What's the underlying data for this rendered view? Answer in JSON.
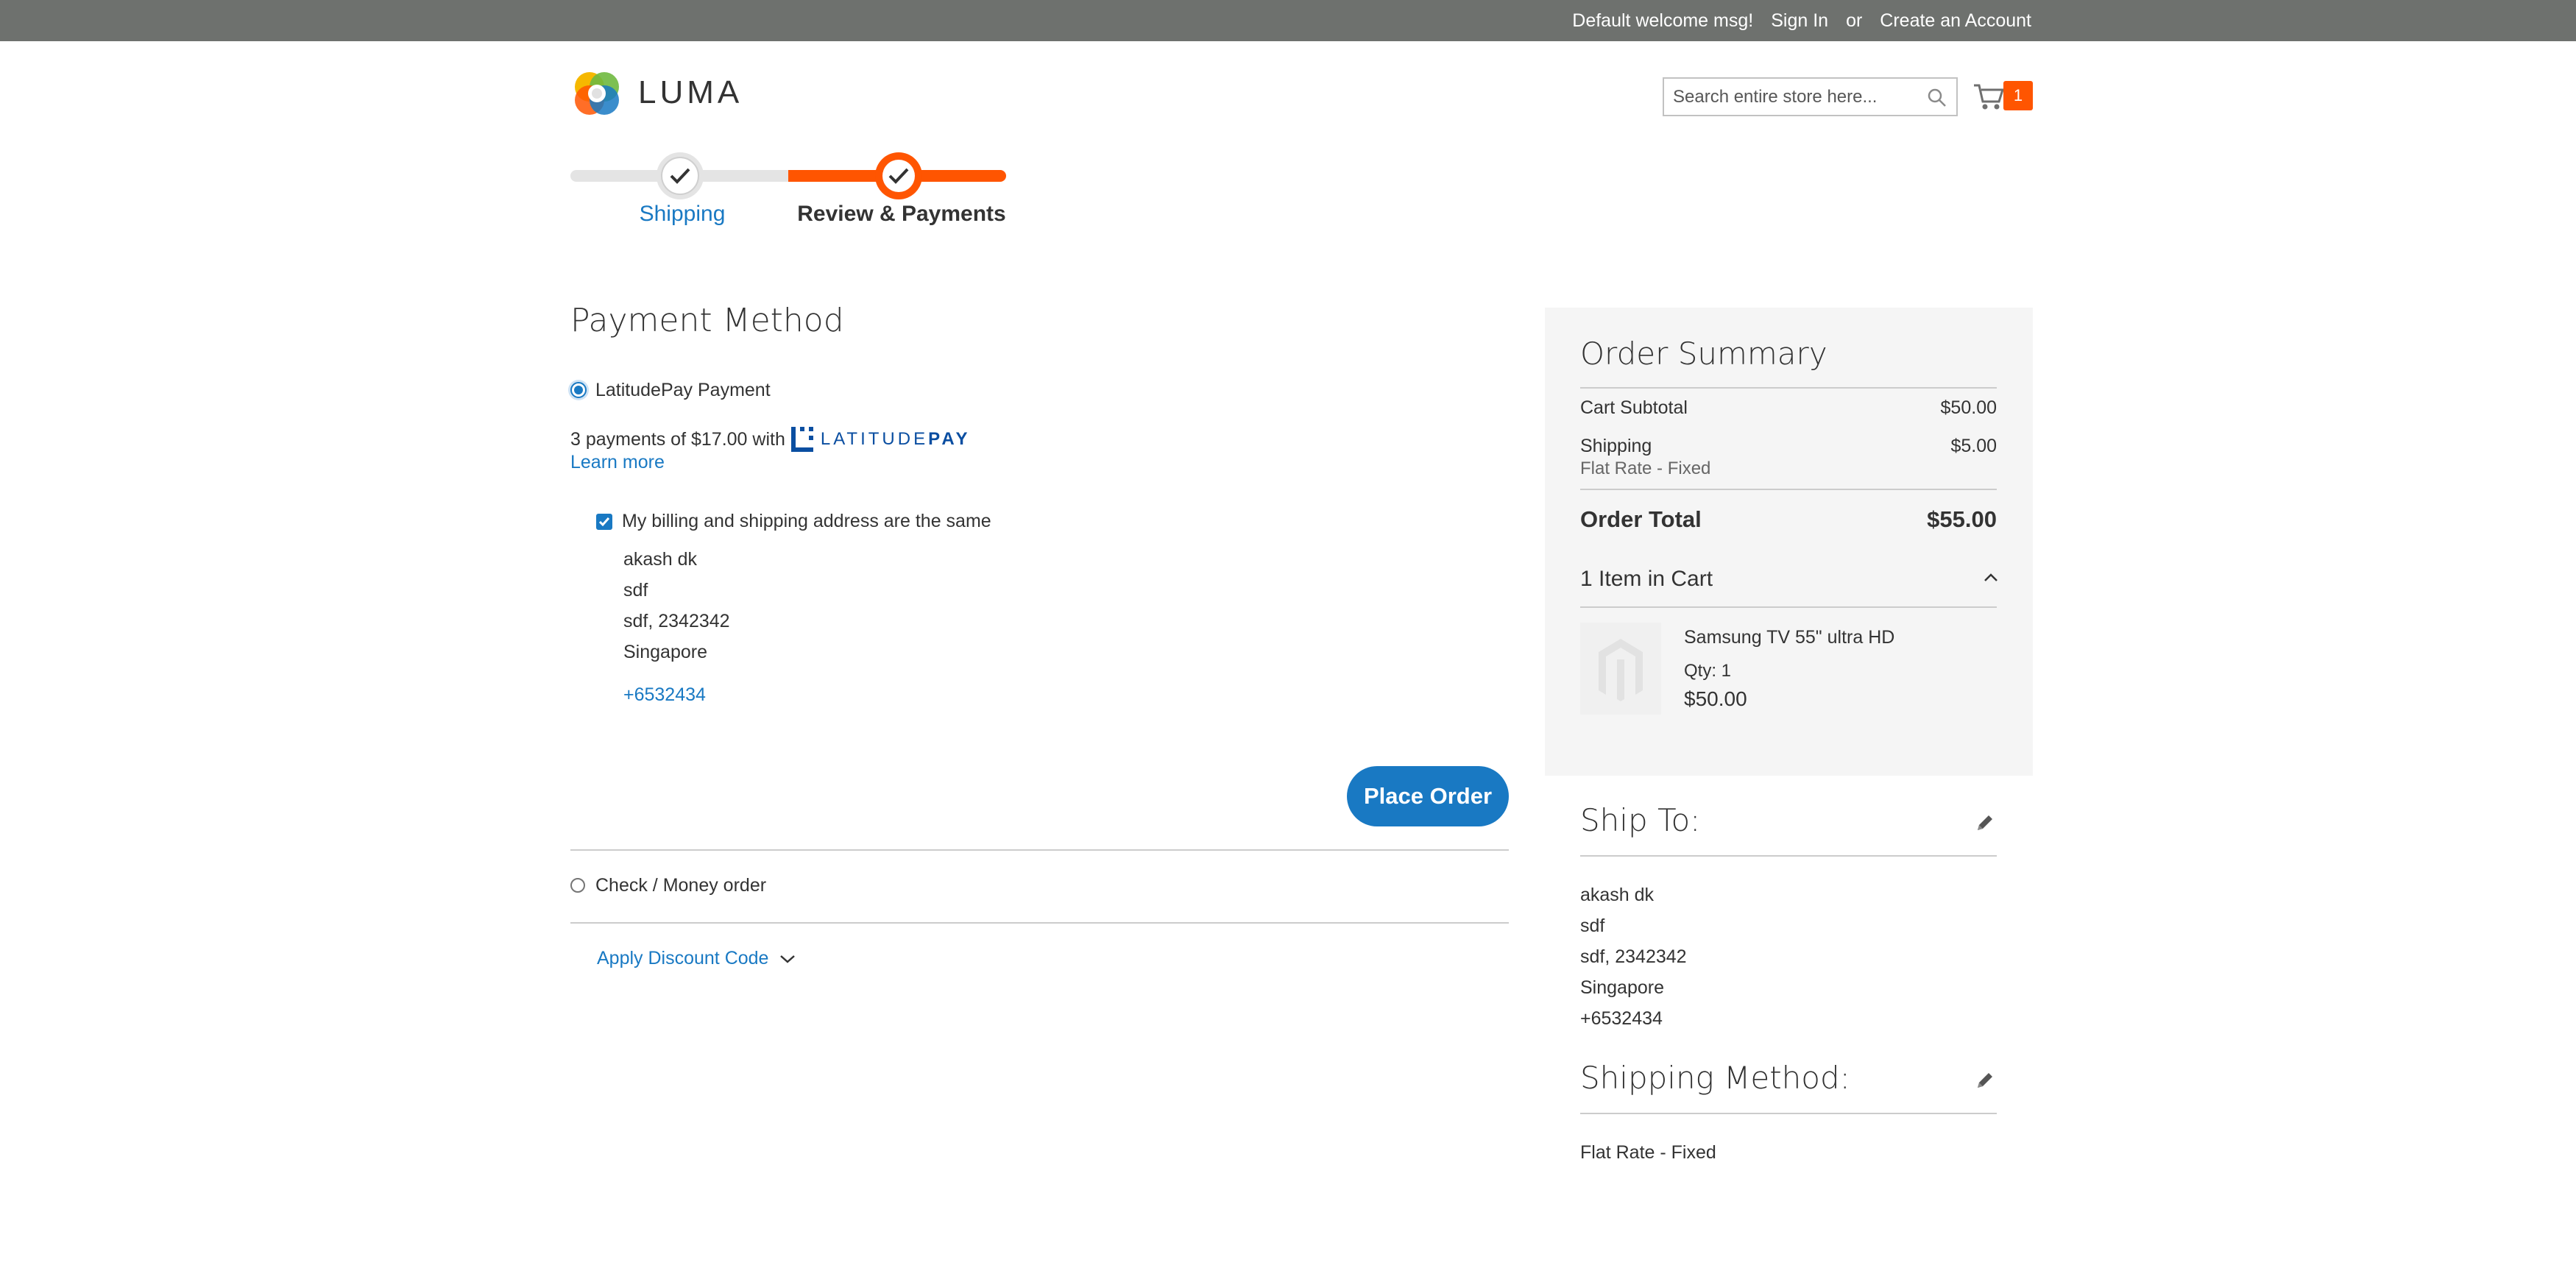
{
  "topbar": {
    "welcome": "Default welcome msg!",
    "sign_in": "Sign In",
    "or": "or",
    "create_account": "Create an Account"
  },
  "header": {
    "logo_text": "LUMA",
    "search_placeholder": "Search entire store here...",
    "cart_count": "1"
  },
  "progress": {
    "steps": [
      {
        "label": "Shipping",
        "state": "complete"
      },
      {
        "label": "Review & Payments",
        "state": "active"
      }
    ]
  },
  "payment": {
    "title": "Payment Method",
    "options": [
      {
        "label": "LatitudePay Payment",
        "selected": true
      },
      {
        "label": "Check / Money order",
        "selected": false
      }
    ],
    "installments_text": "3 payments of $17.00 with",
    "provider_logo_text": "LATITUDE",
    "provider_logo_bold": "PAY",
    "learn_more": "Learn more",
    "same_address_label": "My billing and shipping address are the same",
    "billing_address": {
      "name": "akash dk",
      "street": "sdf",
      "city_zip": "sdf, 2342342",
      "country": "Singapore",
      "phone": "+6532434"
    },
    "place_order": "Place Order",
    "discount_link": "Apply Discount Code"
  },
  "summary": {
    "title": "Order Summary",
    "cart_subtotal_label": "Cart Subtotal",
    "cart_subtotal_value": "$50.00",
    "shipping_label": "Shipping",
    "shipping_value": "$5.00",
    "shipping_method": "Flat Rate - Fixed",
    "order_total_label": "Order Total",
    "order_total_value": "$55.00",
    "items_in_cart": "1 Item in Cart",
    "item": {
      "name": "Samsung TV 55\" ultra HD",
      "qty": "Qty: 1",
      "price": "$50.00"
    }
  },
  "ship_to": {
    "title": "Ship To:",
    "name": "akash dk",
    "street": "sdf",
    "city_zip": "sdf, 2342342",
    "country": "Singapore",
    "phone": "+6532434"
  },
  "shipping_method_block": {
    "title": "Shipping Method:",
    "value": "Flat Rate - Fixed"
  },
  "colors": {
    "accent": "#1979c3",
    "brand_orange": "#ff5501",
    "topbar": "#6e716e",
    "summary_bg": "#f5f5f5"
  }
}
